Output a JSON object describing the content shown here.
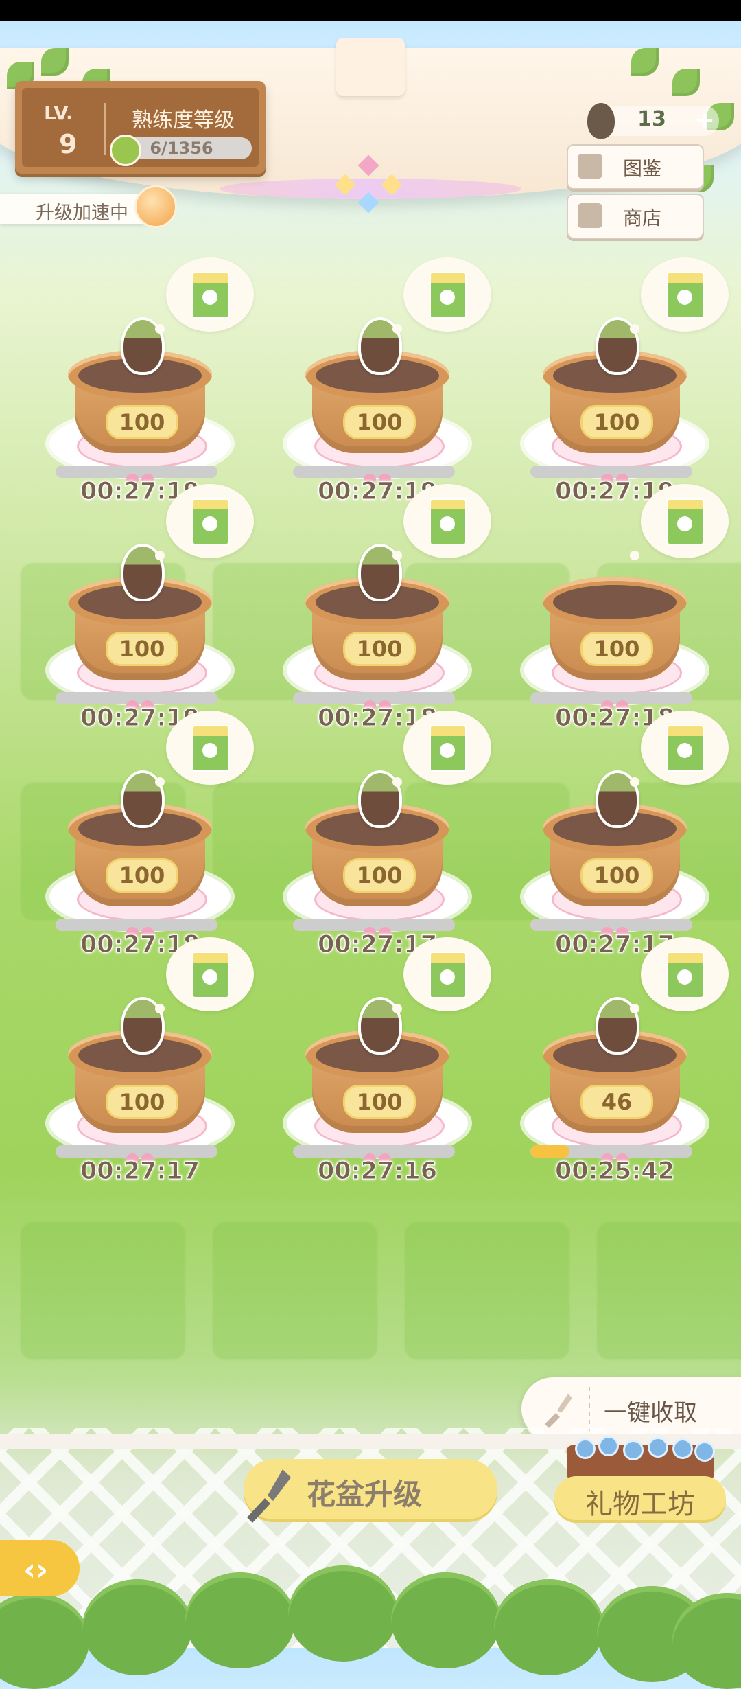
{
  "level": {
    "label": "LV.",
    "value": "9",
    "proficiency_title": "熟练度等级",
    "progress_text": "6/1356",
    "progress_fraction": 0.0044
  },
  "boost": {
    "label": "升级加速中"
  },
  "currency": {
    "seed_count": "13",
    "plus_label": "+"
  },
  "side_buttons": {
    "encyclopedia": "图鉴",
    "shop": "商店"
  },
  "pots": [
    {
      "level": "100",
      "timer": "00:27:19",
      "progress": 0,
      "has_seed": true
    },
    {
      "level": "100",
      "timer": "00:27:19",
      "progress": 0,
      "has_seed": true
    },
    {
      "level": "100",
      "timer": "00:27:19",
      "progress": 0,
      "has_seed": true
    },
    {
      "level": "100",
      "timer": "00:27:19",
      "progress": 0,
      "has_seed": true
    },
    {
      "level": "100",
      "timer": "00:27:18",
      "progress": 0,
      "has_seed": true
    },
    {
      "level": "100",
      "timer": "00:27:18",
      "progress": 0,
      "has_seed": false
    },
    {
      "level": "100",
      "timer": "00:27:18",
      "progress": 0,
      "has_seed": true
    },
    {
      "level": "100",
      "timer": "00:27:17",
      "progress": 0,
      "has_seed": true
    },
    {
      "level": "100",
      "timer": "00:27:17",
      "progress": 0,
      "has_seed": true
    },
    {
      "level": "100",
      "timer": "00:27:17",
      "progress": 0,
      "has_seed": true
    },
    {
      "level": "100",
      "timer": "00:27:16",
      "progress": 0,
      "has_seed": true
    },
    {
      "level": "46",
      "timer": "00:25:42",
      "progress": 0.24,
      "has_seed": true
    }
  ],
  "actions": {
    "collect_all": "一键收取",
    "pot_upgrade": "花盆升级",
    "gift_workshop": "礼物工坊",
    "back_icon": "back-arrow-icon"
  },
  "colors": {
    "accent_yellow": "#f8e487",
    "wood": "#a36b3b",
    "progress_fill": "#f7c241"
  }
}
